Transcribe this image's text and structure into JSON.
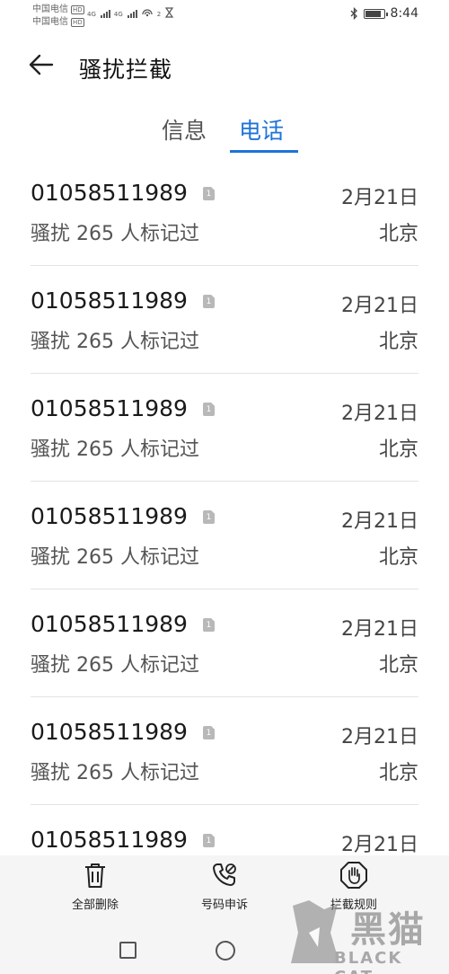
{
  "status_bar": {
    "carrier1": "中国电信",
    "carrier2": "中国电信",
    "hd": "HD",
    "net1": "4G",
    "net2": "4G",
    "net_sub": "4G",
    "hotspot_label": "2",
    "bluetooth_icon": "bluetooth-icon",
    "battery_level": 0.8,
    "time": "8:44"
  },
  "header": {
    "back_icon": "arrow-left-icon",
    "title": "骚扰拦截"
  },
  "tabs": [
    {
      "label": "信息",
      "active": false
    },
    {
      "label": "电话",
      "active": true
    }
  ],
  "accent_color": "#1e73d8",
  "calls": [
    {
      "number": "01058511989",
      "sim": "1",
      "tag": "骚扰  265 人标记过",
      "date": "2月21日",
      "location": "北京"
    },
    {
      "number": "01058511989",
      "sim": "1",
      "tag": "骚扰  265 人标记过",
      "date": "2月21日",
      "location": "北京"
    },
    {
      "number": "01058511989",
      "sim": "1",
      "tag": "骚扰  265 人标记过",
      "date": "2月21日",
      "location": "北京"
    },
    {
      "number": "01058511989",
      "sim": "1",
      "tag": "骚扰  265 人标记过",
      "date": "2月21日",
      "location": "北京"
    },
    {
      "number": "01058511989",
      "sim": "1",
      "tag": "骚扰  265 人标记过",
      "date": "2月21日",
      "location": "北京"
    },
    {
      "number": "01058511989",
      "sim": "1",
      "tag": "骚扰  265 人标记过",
      "date": "2月21日",
      "location": "北京"
    },
    {
      "number": "01058511989",
      "sim": "1",
      "tag": "",
      "date": "2月21日",
      "location": ""
    }
  ],
  "toolbar": {
    "delete_all": "全部删除",
    "number_appeal": "号码申诉",
    "block_rules": "拦截规则"
  },
  "watermark": {
    "brand": "黑猫",
    "sub": "BLACK CAT"
  }
}
